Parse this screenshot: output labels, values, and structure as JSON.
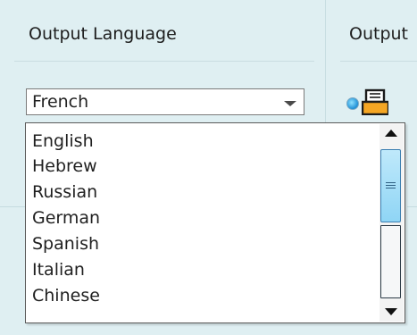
{
  "left_column": {
    "header": "Output Language",
    "select": {
      "value": "French",
      "options": [
        "English",
        "Hebrew",
        "Russian",
        "German",
        "Spanish",
        "Italian",
        "Chinese"
      ]
    }
  },
  "right_column": {
    "header": "Output",
    "radio_selected": true,
    "icon": "printer-icon"
  },
  "colors": {
    "background": "#dfeff2",
    "thumb": "#8fd5f5",
    "printer_orange": "#f5a623"
  }
}
